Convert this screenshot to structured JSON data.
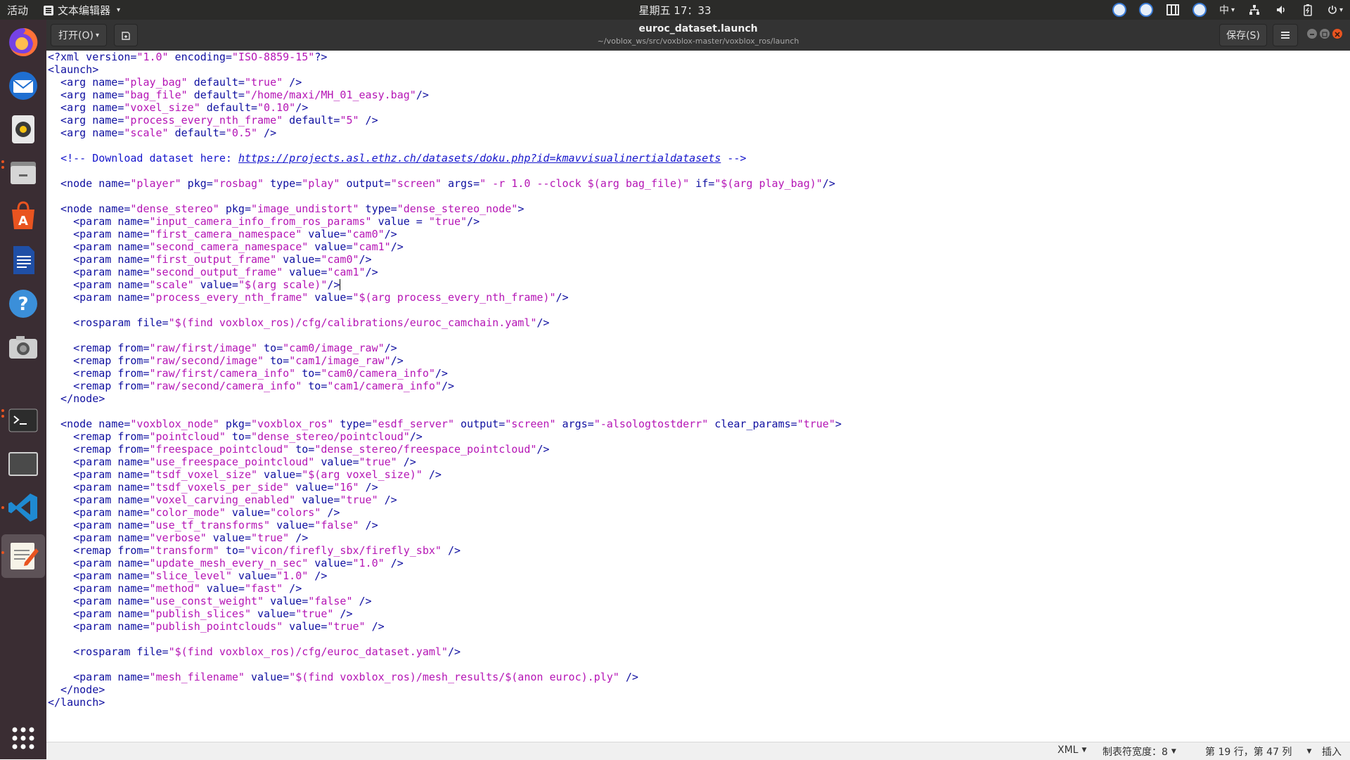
{
  "topbar": {
    "activities": "活动",
    "app_name": "文本编辑器",
    "clock": "星期五 17：33",
    "ime": "中",
    "tray_icons": [
      "baidu-netdisk-icon",
      "baidu-netdisk-icon",
      "window-grid-icon",
      "baidu-netdisk-icon",
      "input-method-icon",
      "network-icon",
      "volume-icon",
      "battery-icon",
      "power-icon"
    ]
  },
  "dock": {
    "items": [
      "firefox-icon",
      "thunderbird-icon",
      "rhythmbox-icon",
      "files-icon",
      "software-center-icon",
      "libreoffice-writer-icon",
      "help-icon",
      "screenshot-icon",
      "terminal-icon",
      "window-icon",
      "vscode-icon",
      "text-editor-icon"
    ],
    "apps_grid": "show-applications-icon"
  },
  "header": {
    "open_label": "打开(O)",
    "save_label": "保存(S)",
    "title": "euroc_dataset.launch",
    "path": "~/voblox_ws/src/voxblox-master/voxblox_ros/launch"
  },
  "editor": {
    "lines": [
      "<?xml version=\"1.0\" encoding=\"ISO-8859-15\"?>",
      "<launch>",
      "  <arg name=\"play_bag\" default=\"true\" />",
      "  <arg name=\"bag_file\" default=\"/home/maxi/MH_01_easy.bag\"/>",
      "  <arg name=\"voxel_size\" default=\"0.10\"/>",
      "  <arg name=\"process_every_nth_frame\" default=\"5\" />",
      "  <arg name=\"scale\" default=\"0.5\" />",
      "",
      "  <!-- Download dataset here: https://projects.asl.ethz.ch/datasets/doku.php?id=kmavvisualinertialdatasets -->",
      "",
      "  <node name=\"player\" pkg=\"rosbag\" type=\"play\" output=\"screen\" args=\" -r 1.0 --clock $(arg bag_file)\" if=\"$(arg play_bag)\"/>",
      "",
      "  <node name=\"dense_stereo\" pkg=\"image_undistort\" type=\"dense_stereo_node\">",
      "    <param name=\"input_camera_info_from_ros_params\" value = \"true\"/>",
      "    <param name=\"first_camera_namespace\" value=\"cam0\"/>",
      "    <param name=\"second_camera_namespace\" value=\"cam1\"/>",
      "    <param name=\"first_output_frame\" value=\"cam0\"/>",
      "    <param name=\"second_output_frame\" value=\"cam1\"/>",
      "    <param name=\"scale\" value=\"$(arg scale)\"/>",
      "    <param name=\"process_every_nth_frame\" value=\"$(arg process_every_nth_frame)\"/>",
      "",
      "    <rosparam file=\"$(find voxblox_ros)/cfg/calibrations/euroc_camchain.yaml\"/>",
      "",
      "    <remap from=\"raw/first/image\" to=\"cam0/image_raw\"/>",
      "    <remap from=\"raw/second/image\" to=\"cam1/image_raw\"/>",
      "    <remap from=\"raw/first/camera_info\" to=\"cam0/camera_info\"/>",
      "    <remap from=\"raw/second/camera_info\" to=\"cam1/camera_info\"/>",
      "  </node>",
      "",
      "  <node name=\"voxblox_node\" pkg=\"voxblox_ros\" type=\"esdf_server\" output=\"screen\" args=\"-alsologtostderr\" clear_params=\"true\">",
      "    <remap from=\"pointcloud\" to=\"dense_stereo/pointcloud\"/>",
      "    <remap from=\"freespace_pointcloud\" to=\"dense_stereo/freespace_pointcloud\"/>",
      "    <param name=\"use_freespace_pointcloud\" value=\"true\" />",
      "    <param name=\"tsdf_voxel_size\" value=\"$(arg voxel_size)\" />",
      "    <param name=\"tsdf_voxels_per_side\" value=\"16\" />",
      "    <param name=\"voxel_carving_enabled\" value=\"true\" />",
      "    <param name=\"color_mode\" value=\"colors\" />",
      "    <param name=\"use_tf_transforms\" value=\"false\" />",
      "    <param name=\"verbose\" value=\"true\" />",
      "    <remap from=\"transform\" to=\"vicon/firefly_sbx/firefly_sbx\" />",
      "    <param name=\"update_mesh_every_n_sec\" value=\"1.0\" />",
      "    <param name=\"slice_level\" value=\"1.0\" />",
      "    <param name=\"method\" value=\"fast\" />",
      "    <param name=\"use_const_weight\" value=\"false\" />",
      "    <param name=\"publish_slices\" value=\"true\" />",
      "    <param name=\"publish_pointclouds\" value=\"true\" />",
      "",
      "    <rosparam file=\"$(find voxblox_ros)/cfg/euroc_dataset.yaml\"/>",
      "",
      "    <param name=\"mesh_filename\" value=\"$(find voxblox_ros)/mesh_results/$(anon euroc).ply\" />",
      "  </node>",
      "</launch>"
    ],
    "cursor_line": 19,
    "cursor_col": 47
  },
  "statusbar": {
    "language": "XML",
    "tab_width": "制表符宽度：8",
    "position": "第 19 行，第 47 列",
    "mode": "插入"
  },
  "colors": {
    "topbar_bg": "#2b2b29",
    "dock_bg": "#3a2d33",
    "headerbar_bg": "#333333",
    "tag_color": "#0f0fa0",
    "value_color": "#b515b5",
    "comment_color": "#1515cc",
    "accent": "#e95420"
  }
}
